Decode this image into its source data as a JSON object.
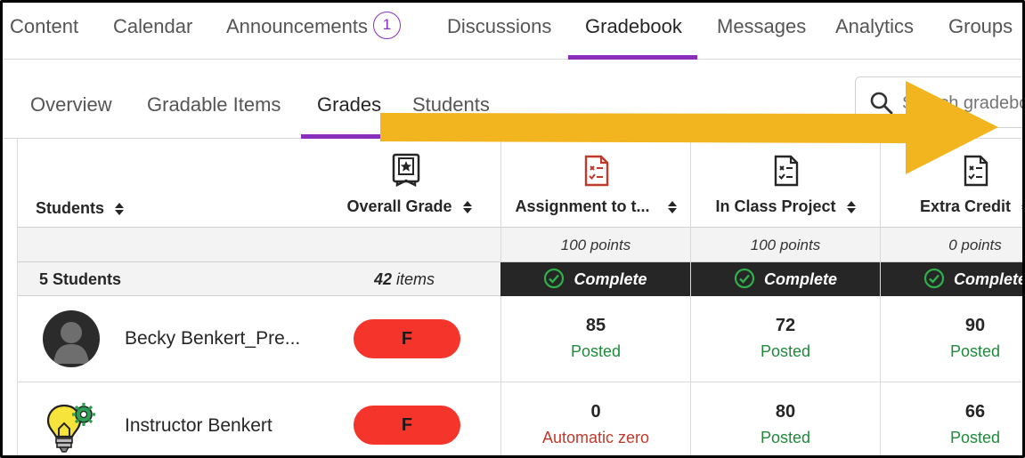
{
  "colors": {
    "accent": "#8a2ebd",
    "fail": "#f5352b",
    "posted": "#1f8a3a",
    "zero": "#c0392b",
    "arrow": "#f2b51f",
    "dark": "#262626"
  },
  "topnav": {
    "tabs": [
      {
        "label": "Content"
      },
      {
        "label": "Calendar"
      },
      {
        "label": "Announcements",
        "badge": "1"
      },
      {
        "label": "Discussions"
      },
      {
        "label": "Gradebook",
        "active": true
      },
      {
        "label": "Messages"
      },
      {
        "label": "Analytics"
      },
      {
        "label": "Groups"
      }
    ]
  },
  "subnav": {
    "tabs": [
      {
        "label": "Overview"
      },
      {
        "label": "Gradable Items"
      },
      {
        "label": "Grades",
        "active": true
      },
      {
        "label": "Students"
      }
    ],
    "search_placeholder": "Search gradebook"
  },
  "table": {
    "students_header": "Students",
    "overall_header": "Overall Grade",
    "columns": [
      {
        "title": "Assignment to t...",
        "icon": "assignment-icon-red",
        "points": "100 points",
        "status": "Complete"
      },
      {
        "title": "In Class Project",
        "icon": "assignment-icon",
        "points": "100 points",
        "status": "Complete"
      },
      {
        "title": "Extra Credit",
        "icon": "assignment-icon",
        "points": "0 points",
        "status": "Complete"
      }
    ],
    "summary": {
      "count": "5 Students",
      "items_num": "42",
      "items_label": "items"
    },
    "rows": [
      {
        "name": "Becky Benkert_Pre...",
        "avatar": "person-avatar",
        "overall": "F",
        "grades": [
          {
            "value": "85",
            "status": "Posted"
          },
          {
            "value": "72",
            "status": "Posted"
          },
          {
            "value": "90",
            "status": "Posted"
          }
        ]
      },
      {
        "name": "Instructor Benkert",
        "avatar": "lightbulb-gear-avatar",
        "overall": "F",
        "grades": [
          {
            "value": "0",
            "status": "Automatic zero"
          },
          {
            "value": "80",
            "status": "Posted"
          },
          {
            "value": "66",
            "status": "Posted"
          }
        ]
      }
    ]
  }
}
